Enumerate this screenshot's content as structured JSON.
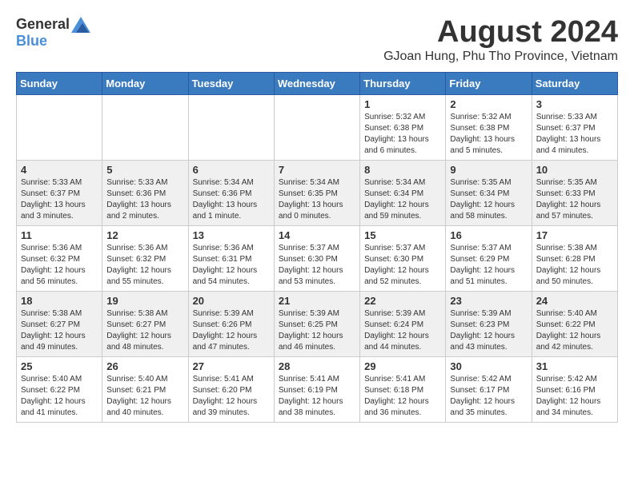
{
  "header": {
    "logo_general": "General",
    "logo_blue": "Blue",
    "month_year": "August 2024",
    "location": "GJoan Hung, Phu Tho Province, Vietnam"
  },
  "weekdays": [
    "Sunday",
    "Monday",
    "Tuesday",
    "Wednesday",
    "Thursday",
    "Friday",
    "Saturday"
  ],
  "weeks": [
    [
      {
        "day": "",
        "info": ""
      },
      {
        "day": "",
        "info": ""
      },
      {
        "day": "",
        "info": ""
      },
      {
        "day": "",
        "info": ""
      },
      {
        "day": "1",
        "info": "Sunrise: 5:32 AM\nSunset: 6:38 PM\nDaylight: 13 hours\nand 6 minutes."
      },
      {
        "day": "2",
        "info": "Sunrise: 5:32 AM\nSunset: 6:38 PM\nDaylight: 13 hours\nand 5 minutes."
      },
      {
        "day": "3",
        "info": "Sunrise: 5:33 AM\nSunset: 6:37 PM\nDaylight: 13 hours\nand 4 minutes."
      }
    ],
    [
      {
        "day": "4",
        "info": "Sunrise: 5:33 AM\nSunset: 6:37 PM\nDaylight: 13 hours\nand 3 minutes."
      },
      {
        "day": "5",
        "info": "Sunrise: 5:33 AM\nSunset: 6:36 PM\nDaylight: 13 hours\nand 2 minutes."
      },
      {
        "day": "6",
        "info": "Sunrise: 5:34 AM\nSunset: 6:36 PM\nDaylight: 13 hours\nand 1 minute."
      },
      {
        "day": "7",
        "info": "Sunrise: 5:34 AM\nSunset: 6:35 PM\nDaylight: 13 hours\nand 0 minutes."
      },
      {
        "day": "8",
        "info": "Sunrise: 5:34 AM\nSunset: 6:34 PM\nDaylight: 12 hours\nand 59 minutes."
      },
      {
        "day": "9",
        "info": "Sunrise: 5:35 AM\nSunset: 6:34 PM\nDaylight: 12 hours\nand 58 minutes."
      },
      {
        "day": "10",
        "info": "Sunrise: 5:35 AM\nSunset: 6:33 PM\nDaylight: 12 hours\nand 57 minutes."
      }
    ],
    [
      {
        "day": "11",
        "info": "Sunrise: 5:36 AM\nSunset: 6:32 PM\nDaylight: 12 hours\nand 56 minutes."
      },
      {
        "day": "12",
        "info": "Sunrise: 5:36 AM\nSunset: 6:32 PM\nDaylight: 12 hours\nand 55 minutes."
      },
      {
        "day": "13",
        "info": "Sunrise: 5:36 AM\nSunset: 6:31 PM\nDaylight: 12 hours\nand 54 minutes."
      },
      {
        "day": "14",
        "info": "Sunrise: 5:37 AM\nSunset: 6:30 PM\nDaylight: 12 hours\nand 53 minutes."
      },
      {
        "day": "15",
        "info": "Sunrise: 5:37 AM\nSunset: 6:30 PM\nDaylight: 12 hours\nand 52 minutes."
      },
      {
        "day": "16",
        "info": "Sunrise: 5:37 AM\nSunset: 6:29 PM\nDaylight: 12 hours\nand 51 minutes."
      },
      {
        "day": "17",
        "info": "Sunrise: 5:38 AM\nSunset: 6:28 PM\nDaylight: 12 hours\nand 50 minutes."
      }
    ],
    [
      {
        "day": "18",
        "info": "Sunrise: 5:38 AM\nSunset: 6:27 PM\nDaylight: 12 hours\nand 49 minutes."
      },
      {
        "day": "19",
        "info": "Sunrise: 5:38 AM\nSunset: 6:27 PM\nDaylight: 12 hours\nand 48 minutes."
      },
      {
        "day": "20",
        "info": "Sunrise: 5:39 AM\nSunset: 6:26 PM\nDaylight: 12 hours\nand 47 minutes."
      },
      {
        "day": "21",
        "info": "Sunrise: 5:39 AM\nSunset: 6:25 PM\nDaylight: 12 hours\nand 46 minutes."
      },
      {
        "day": "22",
        "info": "Sunrise: 5:39 AM\nSunset: 6:24 PM\nDaylight: 12 hours\nand 44 minutes."
      },
      {
        "day": "23",
        "info": "Sunrise: 5:39 AM\nSunset: 6:23 PM\nDaylight: 12 hours\nand 43 minutes."
      },
      {
        "day": "24",
        "info": "Sunrise: 5:40 AM\nSunset: 6:22 PM\nDaylight: 12 hours\nand 42 minutes."
      }
    ],
    [
      {
        "day": "25",
        "info": "Sunrise: 5:40 AM\nSunset: 6:22 PM\nDaylight: 12 hours\nand 41 minutes."
      },
      {
        "day": "26",
        "info": "Sunrise: 5:40 AM\nSunset: 6:21 PM\nDaylight: 12 hours\nand 40 minutes."
      },
      {
        "day": "27",
        "info": "Sunrise: 5:41 AM\nSunset: 6:20 PM\nDaylight: 12 hours\nand 39 minutes."
      },
      {
        "day": "28",
        "info": "Sunrise: 5:41 AM\nSunset: 6:19 PM\nDaylight: 12 hours\nand 38 minutes."
      },
      {
        "day": "29",
        "info": "Sunrise: 5:41 AM\nSunset: 6:18 PM\nDaylight: 12 hours\nand 36 minutes."
      },
      {
        "day": "30",
        "info": "Sunrise: 5:42 AM\nSunset: 6:17 PM\nDaylight: 12 hours\nand 35 minutes."
      },
      {
        "day": "31",
        "info": "Sunrise: 5:42 AM\nSunset: 6:16 PM\nDaylight: 12 hours\nand 34 minutes."
      }
    ]
  ],
  "row_colors": [
    "white",
    "gray",
    "white",
    "gray",
    "white"
  ]
}
